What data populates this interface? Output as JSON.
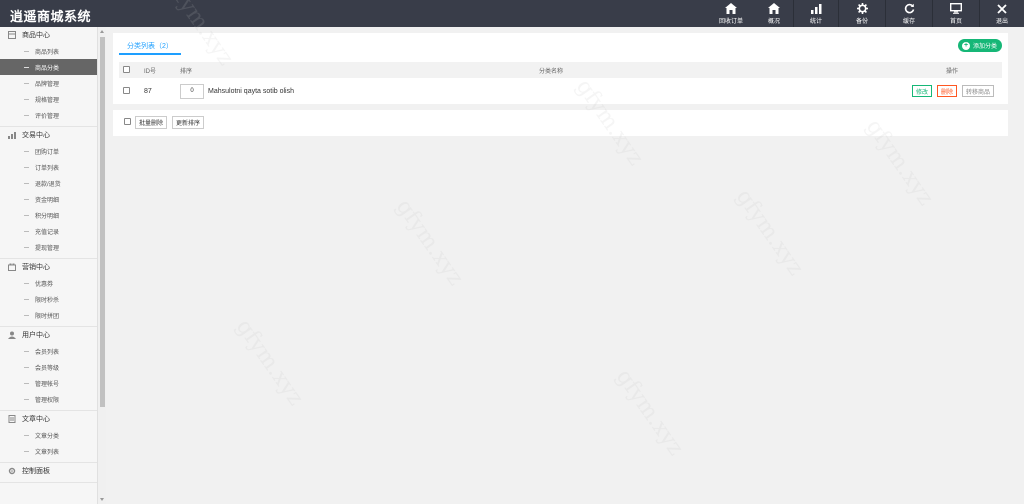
{
  "app": {
    "title": "逍遥商城系统"
  },
  "topnav": [
    {
      "id": "recycle",
      "label": "回收订单",
      "icon": "home-icon"
    },
    {
      "id": "overview",
      "label": "概况",
      "icon": "home-icon"
    },
    {
      "id": "stats",
      "label": "统计",
      "icon": "bar-chart-icon"
    },
    {
      "id": "backup",
      "label": "备份",
      "icon": "gear-icon"
    },
    {
      "id": "cache",
      "label": "缓存",
      "icon": "refresh-icon"
    },
    {
      "id": "home",
      "label": "首页",
      "icon": "monitor-icon"
    },
    {
      "id": "logout",
      "label": "退出",
      "icon": "close-icon"
    }
  ],
  "sidebar": {
    "groups": [
      {
        "title": "商品中心",
        "icon": "goods-icon",
        "items": [
          "商品列表",
          "商品分类",
          "品牌管理",
          "规格管理",
          "评价管理"
        ],
        "active_index": 1
      },
      {
        "title": "交易中心",
        "icon": "trade-icon",
        "items": [
          "团购订单",
          "订单列表",
          "退款/退货",
          "资金明细",
          "积分明细",
          "充值记录",
          "提现管理"
        ]
      },
      {
        "title": "营销中心",
        "icon": "marketing-icon",
        "items": [
          "优惠券",
          "限时秒杀",
          "限时拼团"
        ]
      },
      {
        "title": "用户中心",
        "icon": "user-icon",
        "items": [
          "会员列表",
          "会员等级",
          "管理帐号",
          "管理权限"
        ]
      },
      {
        "title": "文章中心",
        "icon": "article-icon",
        "items": [
          "文章分类",
          "文章列表"
        ]
      },
      {
        "title": "控制面板",
        "icon": "settings-icon",
        "items": []
      }
    ]
  },
  "main": {
    "tab_label": "分类列表（2）",
    "add_button": "添加分类",
    "table": {
      "headers": {
        "id": "ID号",
        "sort": "排序",
        "name": "分类名称",
        "ops": "操作"
      },
      "rows": [
        {
          "id": "87",
          "sort": "0",
          "name": "Mahsulotni qayta sotib olish"
        }
      ],
      "row_ops": {
        "edit": "修改",
        "delete": "删除",
        "move": "转移商品"
      }
    },
    "bottom": {
      "batch_delete": "批量删除",
      "update_sort": "更新排序"
    }
  },
  "watermark": "gfym.xyz",
  "colors": {
    "topbar": "#393d49",
    "accent": "#1e9fff",
    "green": "#16b777",
    "danger": "#ff5722",
    "sidebar_active": "#666666"
  }
}
